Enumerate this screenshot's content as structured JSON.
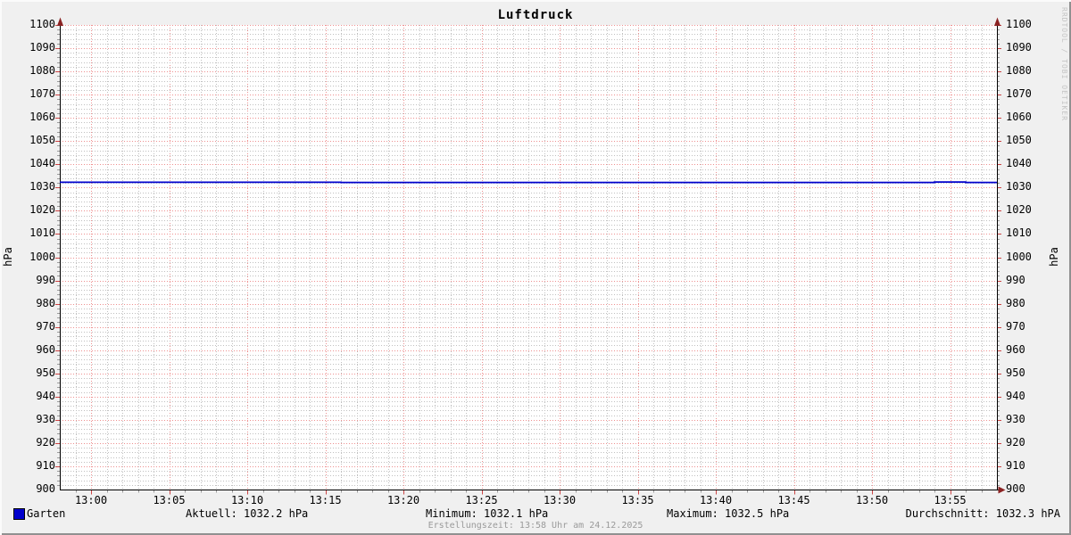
{
  "title": "Luftdruck",
  "watermark": "RRDTOOL / TOBI OETIKER",
  "footer": "Erstellungszeit: 13:58 Uhr am 24.12.2025",
  "y_unit_left": "hPa",
  "y_unit_right": "hPa",
  "legend": {
    "series_label": "Garten",
    "series_color": "#0000cc",
    "stats": [
      "Aktuell: 1032.2 hPa",
      "Minimum: 1032.1 hPa",
      "Maximum: 1032.5 hPa",
      "Durchschnitt: 1032.3 hPA"
    ]
  },
  "colors": {
    "background": "#f0f0f0",
    "canvas": "#ffffff",
    "axis": "#000000",
    "arrow": "#8b2323",
    "grid_minor": "#c0c0c0",
    "grid_major": "#ee9090",
    "tick_minor": "#9a9a9a",
    "tick_major": "#cc4444",
    "footer_text": "#9a9a9a",
    "watermark_text": "#c4c4c4"
  },
  "chart_data": {
    "type": "line",
    "title": "Luftdruck",
    "ylabel": "hPa",
    "ylim": [
      900,
      1100
    ],
    "y_major_step": 10,
    "y_minor_step": 2,
    "yticks": [
      900,
      910,
      920,
      930,
      940,
      950,
      960,
      970,
      980,
      990,
      1000,
      1010,
      1020,
      1030,
      1040,
      1050,
      1060,
      1070,
      1080,
      1090,
      1100
    ],
    "x_start": "12:58",
    "x_end": "13:58",
    "x_minor_step_minutes": 1,
    "xticks": [
      "13:00",
      "13:05",
      "13:10",
      "13:15",
      "13:20",
      "13:25",
      "13:30",
      "13:35",
      "13:40",
      "13:45",
      "13:50",
      "13:55"
    ],
    "grid": true,
    "legend_position": "bottom",
    "series": [
      {
        "name": "Garten",
        "color": "#0000cc",
        "points": [
          [
            "12:58",
            1032.3
          ],
          [
            "13:16",
            1032.3
          ],
          [
            "13:16",
            1032.2
          ],
          [
            "13:54",
            1032.2
          ],
          [
            "13:54",
            1032.4
          ],
          [
            "13:56",
            1032.4
          ],
          [
            "13:56",
            1032.2
          ],
          [
            "13:58",
            1032.2
          ]
        ]
      }
    ],
    "stats": {
      "aktuell_hpa": 1032.2,
      "minimum_hpa": 1032.1,
      "maximum_hpa": 1032.5,
      "durchschnitt_hpa": 1032.3
    }
  }
}
